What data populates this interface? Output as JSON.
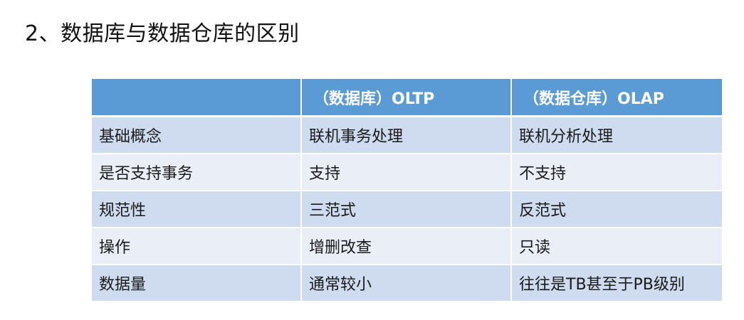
{
  "title": "2、数据库与数据仓库的区别",
  "table": {
    "headers": [
      "",
      "（数据库）OLTP",
      "（数据仓库）OLAP"
    ],
    "rows": [
      [
        "基础概念",
        "联机事务处理",
        "联机分析处理"
      ],
      [
        "是否支持事务",
        "支持",
        "不支持"
      ],
      [
        "规范性",
        "三范式",
        "反范式"
      ],
      [
        "操作",
        "增删改查",
        "只读"
      ],
      [
        "数据量",
        "通常较小",
        "往往是TB甚至于PB级别"
      ]
    ]
  },
  "colors": {
    "header_bg": "#5b9bd5",
    "row_odd_bg": "#cfdbef",
    "row_even_bg": "#e9eef7"
  }
}
